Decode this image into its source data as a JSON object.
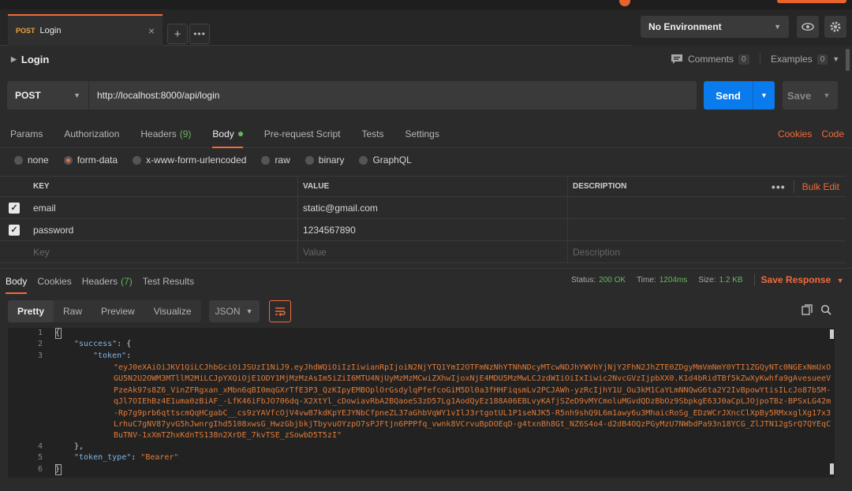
{
  "tab": {
    "method": "POST",
    "name": "Login"
  },
  "environment": {
    "selected": "No Environment"
  },
  "request": {
    "title": "Login",
    "comments_label": "Comments",
    "comments_count": "0",
    "examples_label": "Examples",
    "examples_count": "0",
    "method": "POST",
    "url": "http://localhost:8000/api/login",
    "send_label": "Send",
    "save_label": "Save"
  },
  "req_tabs": [
    {
      "label": "Params"
    },
    {
      "label": "Authorization"
    },
    {
      "label": "Headers",
      "count": "(9)"
    },
    {
      "label": "Body"
    },
    {
      "label": "Pre-request Script"
    },
    {
      "label": "Tests"
    },
    {
      "label": "Settings"
    }
  ],
  "links": {
    "cookies": "Cookies",
    "code": "Code"
  },
  "body_types": [
    "none",
    "form-data",
    "x-www-form-urlencoded",
    "raw",
    "binary",
    "GraphQL"
  ],
  "kv": {
    "headers": {
      "key": "KEY",
      "value": "VALUE",
      "description": "DESCRIPTION",
      "bulk_edit": "Bulk Edit"
    },
    "rows": [
      {
        "key": "email",
        "value": "static@gmail.com"
      },
      {
        "key": "password",
        "value": "1234567890"
      }
    ],
    "placeholders": {
      "key": "Key",
      "value": "Value",
      "description": "Description"
    }
  },
  "response": {
    "tabs": [
      {
        "label": "Body"
      },
      {
        "label": "Cookies"
      },
      {
        "label": "Headers",
        "count": "(7)"
      },
      {
        "label": "Test Results"
      }
    ],
    "status_label": "Status:",
    "status": "200 OK",
    "time_label": "Time:",
    "time": "1204ms",
    "size_label": "Size:",
    "size": "1.2 KB",
    "save_response": "Save Response",
    "views": [
      "Pretty",
      "Raw",
      "Preview",
      "Visualize"
    ],
    "format": "JSON",
    "code": {
      "line_numbers": [
        "1",
        "2",
        "3",
        "4",
        "5",
        "6"
      ],
      "success_key": "\"success\"",
      "token_key": "\"token\"",
      "token_value": "\"eyJ0eXAiOiJKV1QiLCJhbGciOiJSUzI1NiJ9.eyJhdWQiOiIzIiwianRpIjoiN2NjYTQ1YmI2OTFmNzNhYTNhNDcyMTcwNDJhYWVhYjNjY2FhN2JhZTE0ZDgyMmVmNmY0YTI1ZGQyNTc0NGExNmUxOGU5N2U2OWM3MTllM2MiLCJpYXQiOjE1ODY1MjMzMzAsIm5iZiI6MTU4NjUyMzMzMCwiZXhwIjoxNjE4MDU5MzMwLCJzdWIiOiIxIiwic2NvcGVzIjpbXX0.K1d4bRidTBf5kZwXyKwhfa9gAvesueeVPzeAk97s8Z6_VinZFRgxan_xMbn6qBI0mqGXrTfE3P3_QzKIpyEMBOplOrGsdylqPfefcoGiM5Dl0a3fHHFiqsmLv2PCJAWh-yzRcIjhY1U_Ou3kM1CaYLmNNQwG6ta2Y2IvBpowYtisILcJo87b5M-qJl7OIEhBz4E1uma0zBiAF_-LfK46iFbJO706dq-X2XtYl_cDowiavRbA2BQaoeS3zD57Lg1AodQyEz188A06EBLvyKAfjSZeD9vMYCmoluMGvdQDzBbOz9SbpkgE63J0aCpLJOjpoTBz-BPSxLG42m-Rp7g9prb6qttscmQqHCgabC__cs9zYAVfcOjV4vw87kdKpYEJYNbCfpneZL37aGhbVqWY1vIlJ3rtgotUL1P1seNJK5-R5nh9shQ9L6m1awy6u3MhaicRoSg_EDzWCrJXncClXpBy5RMxxglXg17x3LrhuC7gNV87yvG5hJwnrgIhd5108xwsG_HwzGbjbkjTbyvuOYzpO7sPJFtjn6PPPfq_vwnk8VCrvuBpDOEqD-g4txnBh8Gt_NZ6S4o4-d2dB4OQzPGyMzU7NWbdPa93n18YCG_ZlJTN12gSrQ7QYEqCBuTNV-1xXmTZhxKdnTS138n2XrDE_7kvTSE_zSowbD5T5zI\"",
      "token_type_key": "\"token_type\"",
      "token_type_value": "\"Bearer\""
    }
  }
}
